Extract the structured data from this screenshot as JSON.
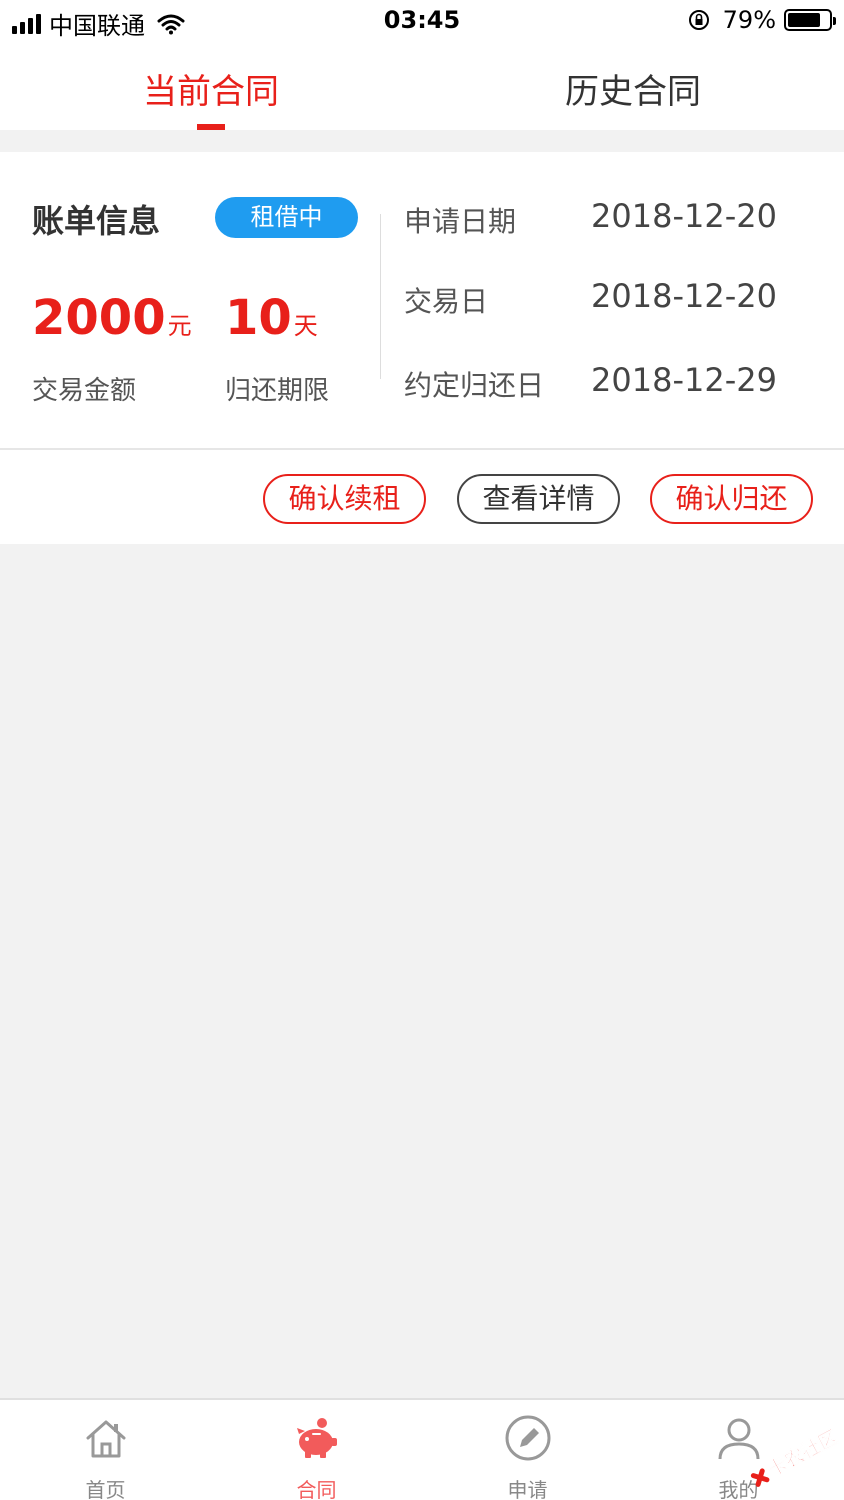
{
  "status_bar": {
    "carrier": "中国联通",
    "time": "03:45",
    "battery_percent": "79%",
    "battery_level": 0.79
  },
  "tabs": [
    {
      "label": "当前合同",
      "active": true
    },
    {
      "label": "历史合同",
      "active": false
    }
  ],
  "bill": {
    "title": "账单信息",
    "status": "租借中",
    "amount": "2000",
    "amount_unit": "元",
    "amount_label": "交易金额",
    "period": "10",
    "period_unit": "天",
    "period_label": "归还期限",
    "info": [
      {
        "label": "申请日期",
        "value": "2018-12-20"
      },
      {
        "label": "交易日",
        "value": "2018-12-20"
      },
      {
        "label": "约定归还日",
        "value": "2018-12-29"
      }
    ]
  },
  "actions": {
    "renew": "确认续租",
    "detail": "查看详情",
    "return": "确认归还"
  },
  "bottom_nav": [
    {
      "label": "首页",
      "icon": "home-icon",
      "active": false
    },
    {
      "label": "合同",
      "icon": "piggy-bank-icon",
      "active": true
    },
    {
      "label": "申请",
      "icon": "pencil-icon",
      "active": false
    },
    {
      "label": "我的",
      "icon": "user-icon",
      "active": false
    }
  ],
  "watermark": {
    "text": "卡农社区"
  },
  "colors": {
    "accent": "#e8201a",
    "badge": "#1f9cf0",
    "nav_active": "#f25b5b",
    "nav_inactive": "#888888"
  }
}
